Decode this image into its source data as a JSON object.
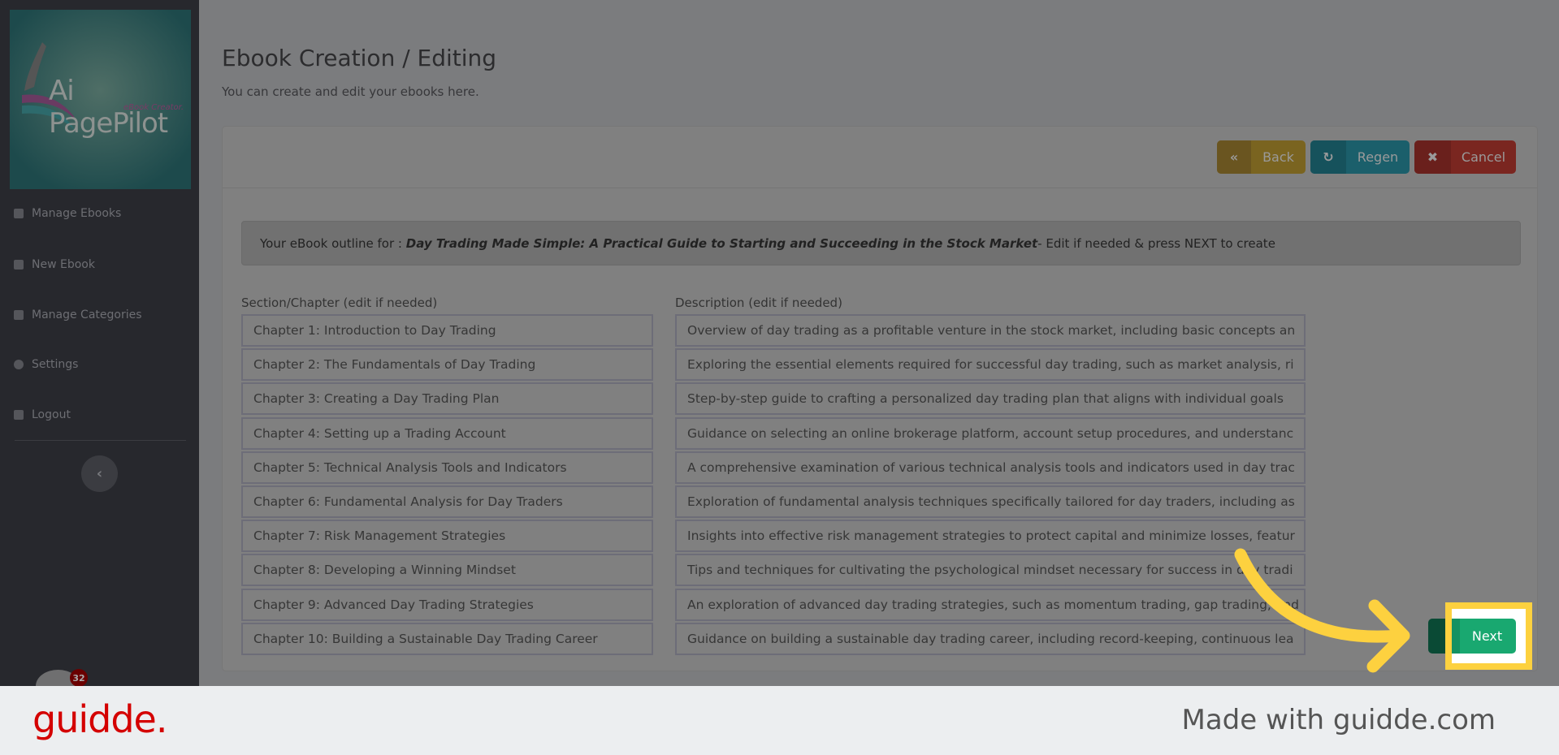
{
  "sidebar": {
    "logo_text": "Ai PagePilot",
    "logo_sub": "eBook Creator.",
    "items": [
      {
        "label": "Manage Ebooks",
        "icon": "clipboard-icon"
      },
      {
        "label": "New Ebook",
        "icon": "book-icon"
      },
      {
        "label": "Manage Categories",
        "icon": "folder-plus-icon"
      },
      {
        "label": "Settings",
        "icon": "gear-icon"
      },
      {
        "label": "Logout",
        "icon": "sign-out-icon"
      }
    ],
    "collapse_glyph": "‹",
    "badge_count": "32"
  },
  "header": {
    "title": "Ebook Creation / Editing",
    "subtitle": "You can create and edit your ebooks here."
  },
  "toolbar": {
    "back_label": "Back",
    "back_glyph": "«",
    "regen_label": "Regen",
    "regen_glyph": "↻",
    "cancel_label": "Cancel",
    "cancel_glyph": "✖",
    "back_color": "#7a6420",
    "regen_color": "#1b5f6b",
    "cancel_color": "#7a2620"
  },
  "alert": {
    "prefix": "Your eBook outline for : ",
    "book_title": "Day Trading Made Simple: A Practical Guide to Starting and Succeeding in the Stock Market",
    "suffix": " - Edit if needed & press NEXT to create"
  },
  "columns": {
    "chapter_label": "Section/Chapter (edit if needed)",
    "desc_label": "Description (edit if needed)"
  },
  "chapters": [
    {
      "title": "Chapter 1: Introduction to Day Trading",
      "desc": "Overview of day trading as a profitable venture in the stock market, including basic concepts an"
    },
    {
      "title": "Chapter 2: The Fundamentals of Day Trading",
      "desc": "Exploring the essential elements required for successful day trading, such as market analysis, ri"
    },
    {
      "title": "Chapter 3: Creating a Day Trading Plan",
      "desc": "Step-by-step guide to crafting a personalized day trading plan that aligns with individual goals"
    },
    {
      "title": "Chapter 4: Setting up a Trading Account",
      "desc": "Guidance on selecting an online brokerage platform, account setup procedures, and understanc"
    },
    {
      "title": "Chapter 5: Technical Analysis Tools and Indicators",
      "desc": "A comprehensive examination of various technical analysis tools and indicators used in day trac"
    },
    {
      "title": "Chapter 6: Fundamental Analysis for Day Traders",
      "desc": "Exploration of fundamental analysis techniques specifically tailored for day traders, including as"
    },
    {
      "title": "Chapter 7: Risk Management Strategies",
      "desc": "Insights into effective risk management strategies to protect capital and minimize losses, featur"
    },
    {
      "title": "Chapter 8: Developing a Winning Mindset",
      "desc": "Tips and techniques for cultivating the psychological mindset necessary for success in day tradi"
    },
    {
      "title": "Chapter 9: Advanced Day Trading Strategies",
      "desc": "An exploration of advanced day trading strategies, such as momentum trading, gap trading, and"
    },
    {
      "title": "Chapter 10: Building a Sustainable Day Trading Career",
      "desc": "Guidance on building a sustainable day trading career, including record-keeping, continuous lea"
    }
  ],
  "next": {
    "label": "Next",
    "color": "#19a870",
    "highlight_color": "#fdd13f"
  },
  "footer": {
    "logo": "guidde.",
    "made_with": "Made with guidde.com"
  }
}
